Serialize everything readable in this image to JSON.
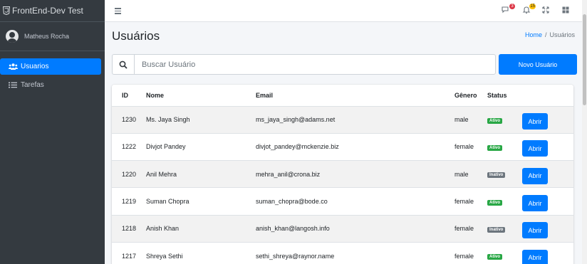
{
  "brand": {
    "title": "FrontEnd-Dev Test"
  },
  "user": {
    "name": "Matheus Rocha"
  },
  "sidebar": {
    "items": [
      {
        "label": "Usuarios",
        "icon": "users-icon",
        "active": true
      },
      {
        "label": "Tarefas",
        "icon": "tasks-icon",
        "active": false
      }
    ]
  },
  "topbar": {
    "messages_count": "3",
    "notifications_count": "15"
  },
  "page": {
    "title": "Usuários"
  },
  "breadcrumb": {
    "home": "Home",
    "separator": "/",
    "current": "Usuários"
  },
  "search": {
    "placeholder": "Buscar Usuário"
  },
  "actions": {
    "new_user": "Novo Usuário"
  },
  "table": {
    "headers": {
      "id": "ID",
      "name": "Nome",
      "email": "Email",
      "gender": "Gênero",
      "status": "Status"
    },
    "open_label": "Abrir",
    "rows": [
      {
        "id": "1230",
        "name": "Ms. Jaya Singh",
        "email": "ms_jaya_singh@adams.net",
        "gender": "male",
        "status": "Ativo"
      },
      {
        "id": "1222",
        "name": "Divjot Pandey",
        "email": "divjot_pandey@mckenzie.biz",
        "gender": "female",
        "status": "Ativo"
      },
      {
        "id": "1220",
        "name": "Anil Mehra",
        "email": "mehra_anil@crona.biz",
        "gender": "male",
        "status": "Inativo"
      },
      {
        "id": "1219",
        "name": "Suman Chopra",
        "email": "suman_chopra@bode.co",
        "gender": "female",
        "status": "Ativo"
      },
      {
        "id": "1218",
        "name": "Anish Khan",
        "email": "anish_khan@langosh.info",
        "gender": "female",
        "status": "Inativo"
      },
      {
        "id": "1217",
        "name": "Shreya Sethi",
        "email": "sethi_shreya@raynor.name",
        "gender": "female",
        "status": "Ativo"
      }
    ]
  },
  "colors": {
    "primary": "#007bff",
    "sidebar_bg": "#343a40",
    "success": "#28a745",
    "secondary": "#6c757d",
    "danger": "#dc3545",
    "warning": "#ffc107"
  }
}
